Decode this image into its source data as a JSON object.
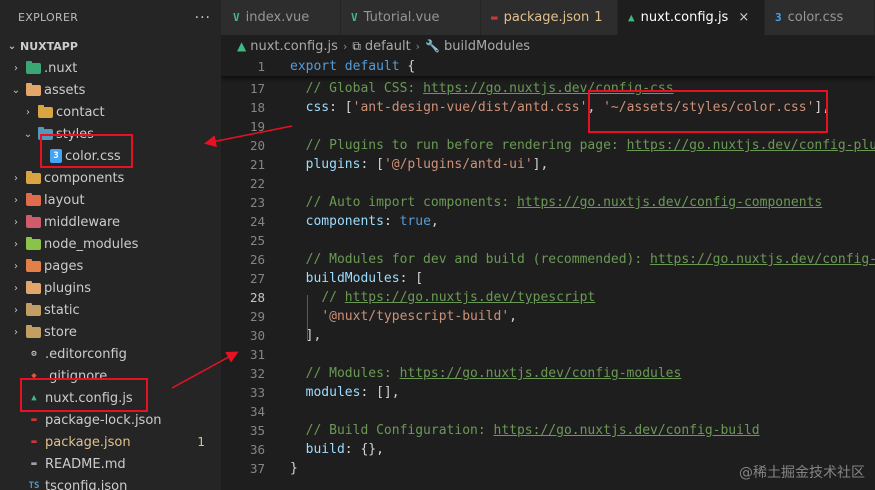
{
  "explorer": {
    "title": "EXPLORER",
    "more": "···",
    "root": "NUXTAPP",
    "items": [
      {
        "label": ".nuxt",
        "kind": "folder",
        "color": "#3aa675",
        "chev": "›",
        "depth": 1
      },
      {
        "label": "assets",
        "kind": "folder",
        "color": "#e2a56a",
        "chev": "⌄",
        "depth": 1
      },
      {
        "label": "contact",
        "kind": "folder",
        "color": "#d9a441",
        "chev": "›",
        "depth": 2
      },
      {
        "label": "styles",
        "kind": "folder",
        "color": "#519aba",
        "chev": "⌄",
        "depth": 2
      },
      {
        "label": "color.css",
        "kind": "css",
        "color": "#42a5f5",
        "depth": 3
      },
      {
        "label": "components",
        "kind": "folder",
        "color": "#d9a441",
        "chev": "›",
        "depth": 1
      },
      {
        "label": "layout",
        "kind": "folder",
        "color": "#e06c4c",
        "chev": "›",
        "depth": 1
      },
      {
        "label": "middleware",
        "kind": "folder",
        "color": "#d05b6b",
        "chev": "›",
        "depth": 1
      },
      {
        "label": "node_modules",
        "kind": "folder",
        "color": "#8bc34a",
        "chev": "›",
        "depth": 1
      },
      {
        "label": "pages",
        "kind": "folder",
        "color": "#e2804a",
        "chev": "›",
        "depth": 1
      },
      {
        "label": "plugins",
        "kind": "folder",
        "color": "#e2a56a",
        "chev": "›",
        "depth": 1
      },
      {
        "label": "static",
        "kind": "folder",
        "color": "#c29e63",
        "chev": "›",
        "depth": 1
      },
      {
        "label": "store",
        "kind": "folder",
        "color": "#c29e63",
        "chev": "›",
        "depth": 1
      },
      {
        "label": ".editorconfig",
        "kind": "file",
        "icon": "⚙",
        "color": "#e0e0e0",
        "depth": 1
      },
      {
        "label": ".gitignore",
        "kind": "file",
        "icon": "◆",
        "color": "#e05a3a",
        "depth": 1
      },
      {
        "label": "nuxt.config.js",
        "kind": "file",
        "icon": "▲",
        "color": "#41b883",
        "depth": 1
      },
      {
        "label": "package-lock.json",
        "kind": "file",
        "icon": "▬",
        "color": "#cb3837",
        "depth": 1
      },
      {
        "label": "package.json",
        "kind": "file",
        "icon": "▬",
        "color": "#cb3837",
        "depth": 1,
        "textColor": "#e2c08d",
        "badge": "1"
      },
      {
        "label": "README.md",
        "kind": "file",
        "icon": "▬",
        "color": "#a0a0a0",
        "depth": 1
      },
      {
        "label": "tsconfig.json",
        "kind": "file",
        "icon": "TS",
        "color": "#519aba",
        "depth": 1
      }
    ]
  },
  "tabs": [
    {
      "label": "index.vue",
      "icon": "V",
      "color": "#41b883"
    },
    {
      "label": "Tutorial.vue",
      "icon": "V",
      "color": "#41b883"
    },
    {
      "label": "package.json",
      "icon": "▬",
      "color": "#cb3837",
      "textColor": "#e2c08d",
      "badge": "1"
    },
    {
      "label": "nuxt.config.js",
      "icon": "▲",
      "color": "#41b883",
      "active": true,
      "close": "×"
    },
    {
      "label": "color.css",
      "icon": "3",
      "color": "#42a5f5"
    }
  ],
  "breadcrumb": {
    "file": "nuxt.config.js",
    "item1": "default",
    "item2": "buildModules"
  },
  "editor": {
    "current_line": "28",
    "lines": [
      {
        "n": "1",
        "html": "<span class='kw'>export</span> <span class='kw'>default</span> {"
      },
      {
        "n": "17",
        "html": "  <span class='cm'>// Global CSS: </span><span class='lnk'>https://go.nuxtjs.dev/config-css</span>"
      },
      {
        "n": "18",
        "html": "  <span class='prop'>css</span>: [<span class='str'>'ant-design-vue/dist/antd.css'</span>, <span class='str'>'~/assets/styles/color.css'</span>],"
      },
      {
        "n": "19",
        "html": ""
      },
      {
        "n": "20",
        "html": "  <span class='cm'>// Plugins to run before rendering page: </span><span class='lnk'>https://go.nuxtjs.dev/config-plugins</span>"
      },
      {
        "n": "21",
        "html": "  <span class='prop'>plugins</span>: [<span class='str'>'@/plugins/antd-ui'</span>],"
      },
      {
        "n": "22",
        "html": ""
      },
      {
        "n": "23",
        "html": "  <span class='cm'>// Auto import components: </span><span class='lnk'>https://go.nuxtjs.dev/config-components</span>"
      },
      {
        "n": "24",
        "html": "  <span class='prop'>components</span>: <span class='cbool'>true</span>,"
      },
      {
        "n": "25",
        "html": ""
      },
      {
        "n": "26",
        "html": "  <span class='cm'>// Modules for dev and build (recommended): </span><span class='lnk'>https://go.nuxtjs.dev/config-modules</span>"
      },
      {
        "n": "27",
        "html": "  <span class='prop'>buildModules</span>: ["
      },
      {
        "n": "28",
        "html": "    <span class='cm'>// </span><span class='lnk'>https://go.nuxtjs.dev/typescript</span>"
      },
      {
        "n": "29",
        "html": "    <span class='str'>'@nuxt/typescript-build'</span>,"
      },
      {
        "n": "30",
        "html": "  ],"
      },
      {
        "n": "31",
        "html": ""
      },
      {
        "n": "32",
        "html": "  <span class='cm'>// Modules: </span><span class='lnk'>https://go.nuxtjs.dev/config-modules</span>"
      },
      {
        "n": "33",
        "html": "  <span class='prop'>modules</span>: [],"
      },
      {
        "n": "34",
        "html": ""
      },
      {
        "n": "35",
        "html": "  <span class='cm'>// Build Configuration: </span><span class='lnk'>https://go.nuxtjs.dev/config-build</span>"
      },
      {
        "n": "36",
        "html": "  <span class='prop'>build</span>: {},"
      },
      {
        "n": "37",
        "html": "}"
      }
    ]
  },
  "watermark": "@稀土掘金技术社区",
  "colors": {
    "annotation": "#e81123",
    "background": "#1e1e1e",
    "sidebar": "#252526"
  }
}
